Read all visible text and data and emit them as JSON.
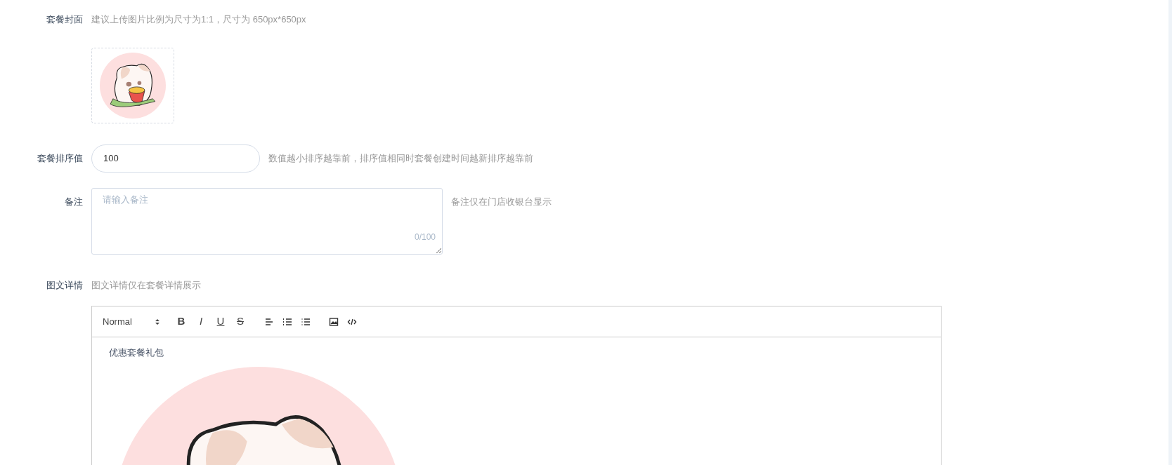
{
  "form": {
    "rows": [
      {
        "kind": "cover",
        "label": "套餐封面",
        "hint": "建议上传图片比例为尺寸为1:1，尺寸为 650px*650px"
      },
      {
        "kind": "input",
        "label": "套餐排序值",
        "value": "100",
        "hint": "数值越小排序越靠前，排序值相同时套餐创建时间越新排序越靠前"
      },
      {
        "kind": "textarea",
        "label": "备注",
        "placeholder": "请输入备注",
        "counter": "0/100",
        "hint": "备注仅在门店收银台显示"
      },
      {
        "kind": "editor",
        "label": "图文详情",
        "hint": "图文详情仅在套餐详情展示"
      }
    ]
  },
  "editor": {
    "toolbar": [
      {
        "kind": "select",
        "text": "Normal"
      },
      {
        "kind": "bold",
        "text": "B"
      },
      {
        "kind": "italic",
        "text": "I"
      },
      {
        "kind": "underline",
        "text": "U"
      },
      {
        "kind": "strike",
        "text": "S"
      },
      {
        "kind": "align"
      },
      {
        "kind": "ordered-list"
      },
      {
        "kind": "bullet-list"
      },
      {
        "kind": "image"
      },
      {
        "kind": "code"
      }
    ],
    "content": [
      {
        "kind": "text",
        "text": "优惠套餐礼包"
      },
      {
        "kind": "image"
      }
    ]
  }
}
